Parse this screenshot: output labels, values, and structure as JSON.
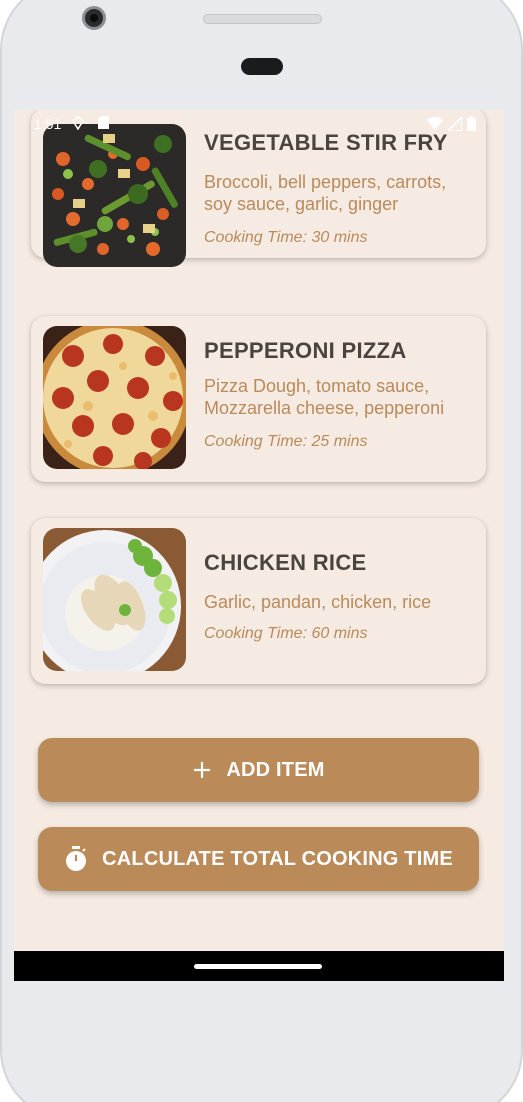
{
  "status_bar": {
    "time": "1:51"
  },
  "recipes": [
    {
      "title": "VEGETABLE STIR FRY",
      "ingredients": "Broccoli, bell peppers, carrots, soy sauce, garlic, ginger",
      "cooking_time": "Cooking Time: 30 mins",
      "image": "vegetable-stir-fry-photo"
    },
    {
      "title": "PEPPERONI PIZZA",
      "ingredients": "Pizza Dough, tomato sauce, Mozzarella cheese, pepperoni",
      "cooking_time": "Cooking Time: 25 mins",
      "image": "pepperoni-pizza-photo"
    },
    {
      "title": "CHICKEN RICE",
      "ingredients": "Garlic, pandan, chicken, rice",
      "cooking_time": "Cooking Time: 60 mins",
      "image": "chicken-rice-photo"
    }
  ],
  "buttons": {
    "add_item": {
      "label": "ADD ITEM",
      "icon": "plus-icon"
    },
    "calculate": {
      "label": "CALCULATE TOTAL COOKING TIME",
      "icon": "stopwatch-icon"
    }
  },
  "colors": {
    "background": "#f5ebe2",
    "button": "#bb8a59",
    "title_text": "#4a4440",
    "accent_text": "#b98a5b"
  }
}
